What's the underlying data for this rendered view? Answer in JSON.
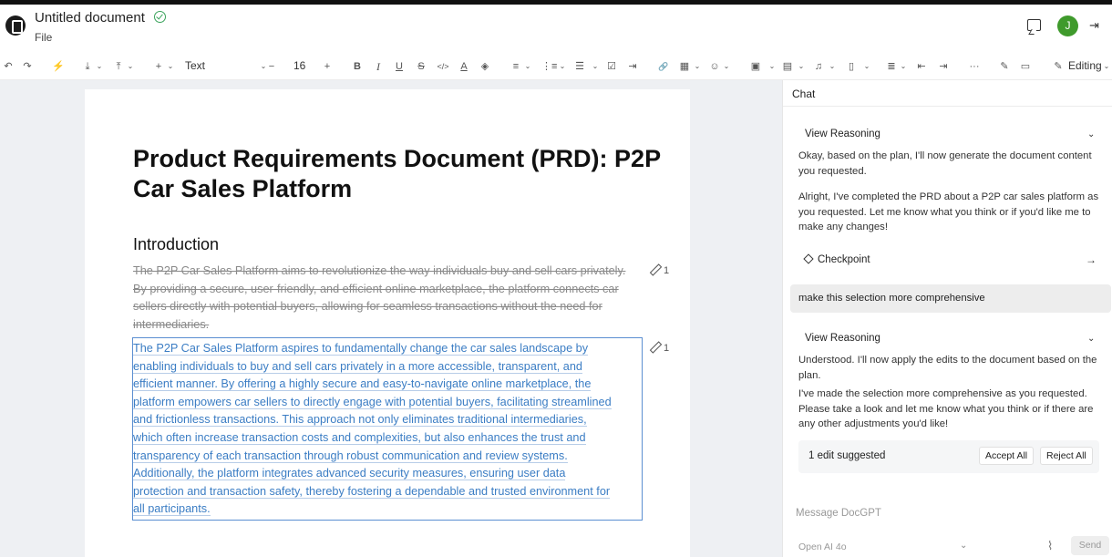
{
  "app": {
    "doc_title": "Untitled document",
    "file_menu": "File",
    "avatar_initial": "J"
  },
  "toolbar": {
    "undo_icon": "↶",
    "redo_icon": "↷",
    "clear_format_icon": "⚡",
    "insert_below_icon": "⤓",
    "insert_above_icon": "⤒",
    "add_icon": "+",
    "style_label": "Text",
    "font_size": "16",
    "bold_label": "B",
    "italic_label": "I",
    "underline_label": "U",
    "strike_label": "S",
    "code_label": "</>",
    "text_color_label": "A",
    "highlight_icon": "◈",
    "align_icon": "≡",
    "ordered_list_icon": "⋮≡",
    "bullet_list_icon": "☰",
    "task_list_icon": "☑",
    "indent_list_icon": "⇥",
    "link_icon": "🔗",
    "table_icon": "▦",
    "emoji_icon": "☺",
    "image_icon": "▣",
    "video_icon": "▤",
    "audio_icon": "♫",
    "file_icon": "▯",
    "line_height_icon": "≣",
    "outdent_icon": "⇤",
    "indent_icon": "⇥",
    "more_icon": "···",
    "editing_label": "Editing"
  },
  "document": {
    "title": "Product Requirements Document (PRD): P2P Car Sales Platform",
    "section_heading": "Introduction",
    "removed_paragraph": "The P2P Car Sales Platform aims to revolutionize the way individuals buy and sell cars privately. By providing a secure, user-friendly, and efficient online marketplace, the platform connects car sellers directly with potential buyers, allowing for seamless transactions without the need for intermediaries.",
    "suggested_lines": [
      "The P2P Car Sales Platform aspires to fundamentally change the car sales landscape by",
      "enabling individuals to buy and sell cars privately in a more accessible, transparent, and",
      "efficient manner. By offering a highly secure and easy-to-navigate online marketplace, the",
      "platform empowers car sellers to directly engage with potential buyers, facilitating streamlined",
      "and frictionless transactions. This approach not only eliminates traditional intermediaries,",
      "which often increase transaction costs and complexities, but also enhances the trust and",
      "transparency of each transaction through robust communication and review systems.",
      "Additionally, the platform integrates advanced security measures, ensuring user data",
      "protection and transaction safety, thereby fostering a dependable and trusted environment for",
      "all participants."
    ],
    "edit_count_1": "1",
    "edit_count_2": "1"
  },
  "chat": {
    "header": "Chat",
    "reasoning_label_1": "View Reasoning",
    "assistant_msg_1a": "Okay, based on the plan, I'll now generate the document content you requested.",
    "assistant_msg_1b": "Alright, I've completed the PRD about a P2P car sales platform as you requested. Let me know what you think or if you'd like me to make any changes!",
    "checkpoint_label": "Checkpoint",
    "user_msg": "make this selection more comprehensive",
    "reasoning_label_2": "View Reasoning",
    "assistant_msg_2a": "Understood. I'll now apply the edits to the document based on the plan.",
    "assistant_msg_2b": "I've made the selection more comprehensive as you requested. Please take a look and let me know what you think or if there are any other adjustments you'd like!",
    "suggestion_label": "1 edit suggested",
    "accept_all": "Accept All",
    "reject_all": "Reject All",
    "composer_placeholder": "Message DocGPT",
    "model": "Open AI 4o",
    "send": "Send"
  }
}
